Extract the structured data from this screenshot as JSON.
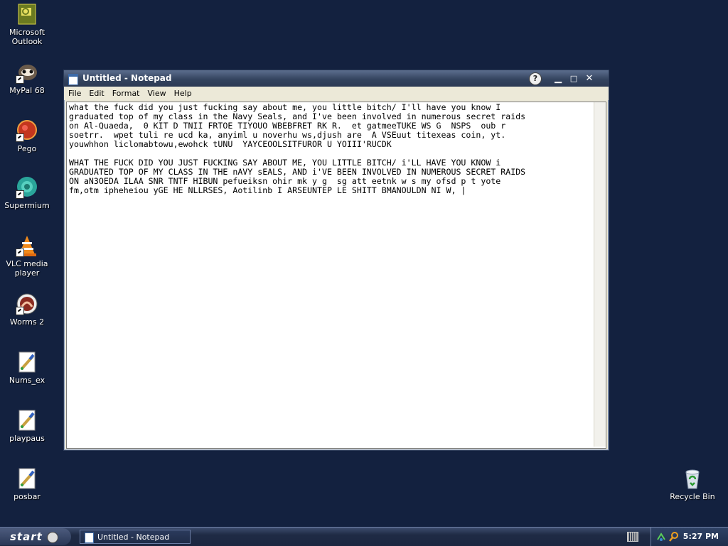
{
  "desktop_icons": [
    {
      "label": "Microsoft Outlook",
      "icon": "outlook-icon"
    },
    {
      "label": "MyPal 68",
      "icon": "mypal-icon"
    },
    {
      "label": "Pego",
      "icon": "pego-icon"
    },
    {
      "label": "Supermium",
      "icon": "supermium-icon"
    },
    {
      "label": "VLC media player",
      "icon": "vlc-icon"
    },
    {
      "label": "Worms 2",
      "icon": "worms-icon"
    },
    {
      "label": "Nums_ex",
      "icon": "paint-file-icon"
    },
    {
      "label": "playpaus",
      "icon": "paint-file-icon"
    },
    {
      "label": "posbar",
      "icon": "paint-file-icon"
    },
    {
      "label": "Recycle Bin",
      "icon": "recycle-bin-icon"
    }
  ],
  "window": {
    "title": "Untitled - Notepad",
    "menu": [
      "File",
      "Edit",
      "Format",
      "View",
      "Help"
    ],
    "content": "what the fuck did you just fucking say about me, you little bitch/ I'll have you know I\ngraduated top of my class in the Navy Seals, and I've been involved in numerous secret raids\non Al-Quaeda,  0 KIT D TNII FRTOE TIYOUO WBEBFRET RK R.  et gatmeeTUKE WS G  NSPS  oub r\nsoetrr.  wpet tuli re ucd ka, anyiml u noverhu ws,djush are  A VSEuut titexeas coin, yt.\nyouwhhon liclomabtowu,ewohck tUNU  YAYCEOOLSITFUROR U YOIII'RUCDK\n\nWHAT THE FUCK DID YOU JUST FUCKING SAY ABOUT ME, YOU LITTLE BITCH/ i'LL HAVE YOU KNOW i\nGRADUATED TOP OF MY CLASS IN THE nAVY sEALS, AND i'VE BEEN INVOLVED IN NUMEROUS SECRET RAIDS\nON aN3OEDA ILAA SNR TNTF HIBUN pefueiksn ohir mk y g  sg att eetnk w s my ofsd p t yote\nfm,otm ipheheiou yGE HE NLLRSES, Aotilinb I ARSEUNTEP LE SHITT BMANOULDN NI W, |"
  },
  "taskbar": {
    "start_label": "start",
    "task_button": "Untitled - Notepad",
    "clock": "5:27 PM"
  }
}
